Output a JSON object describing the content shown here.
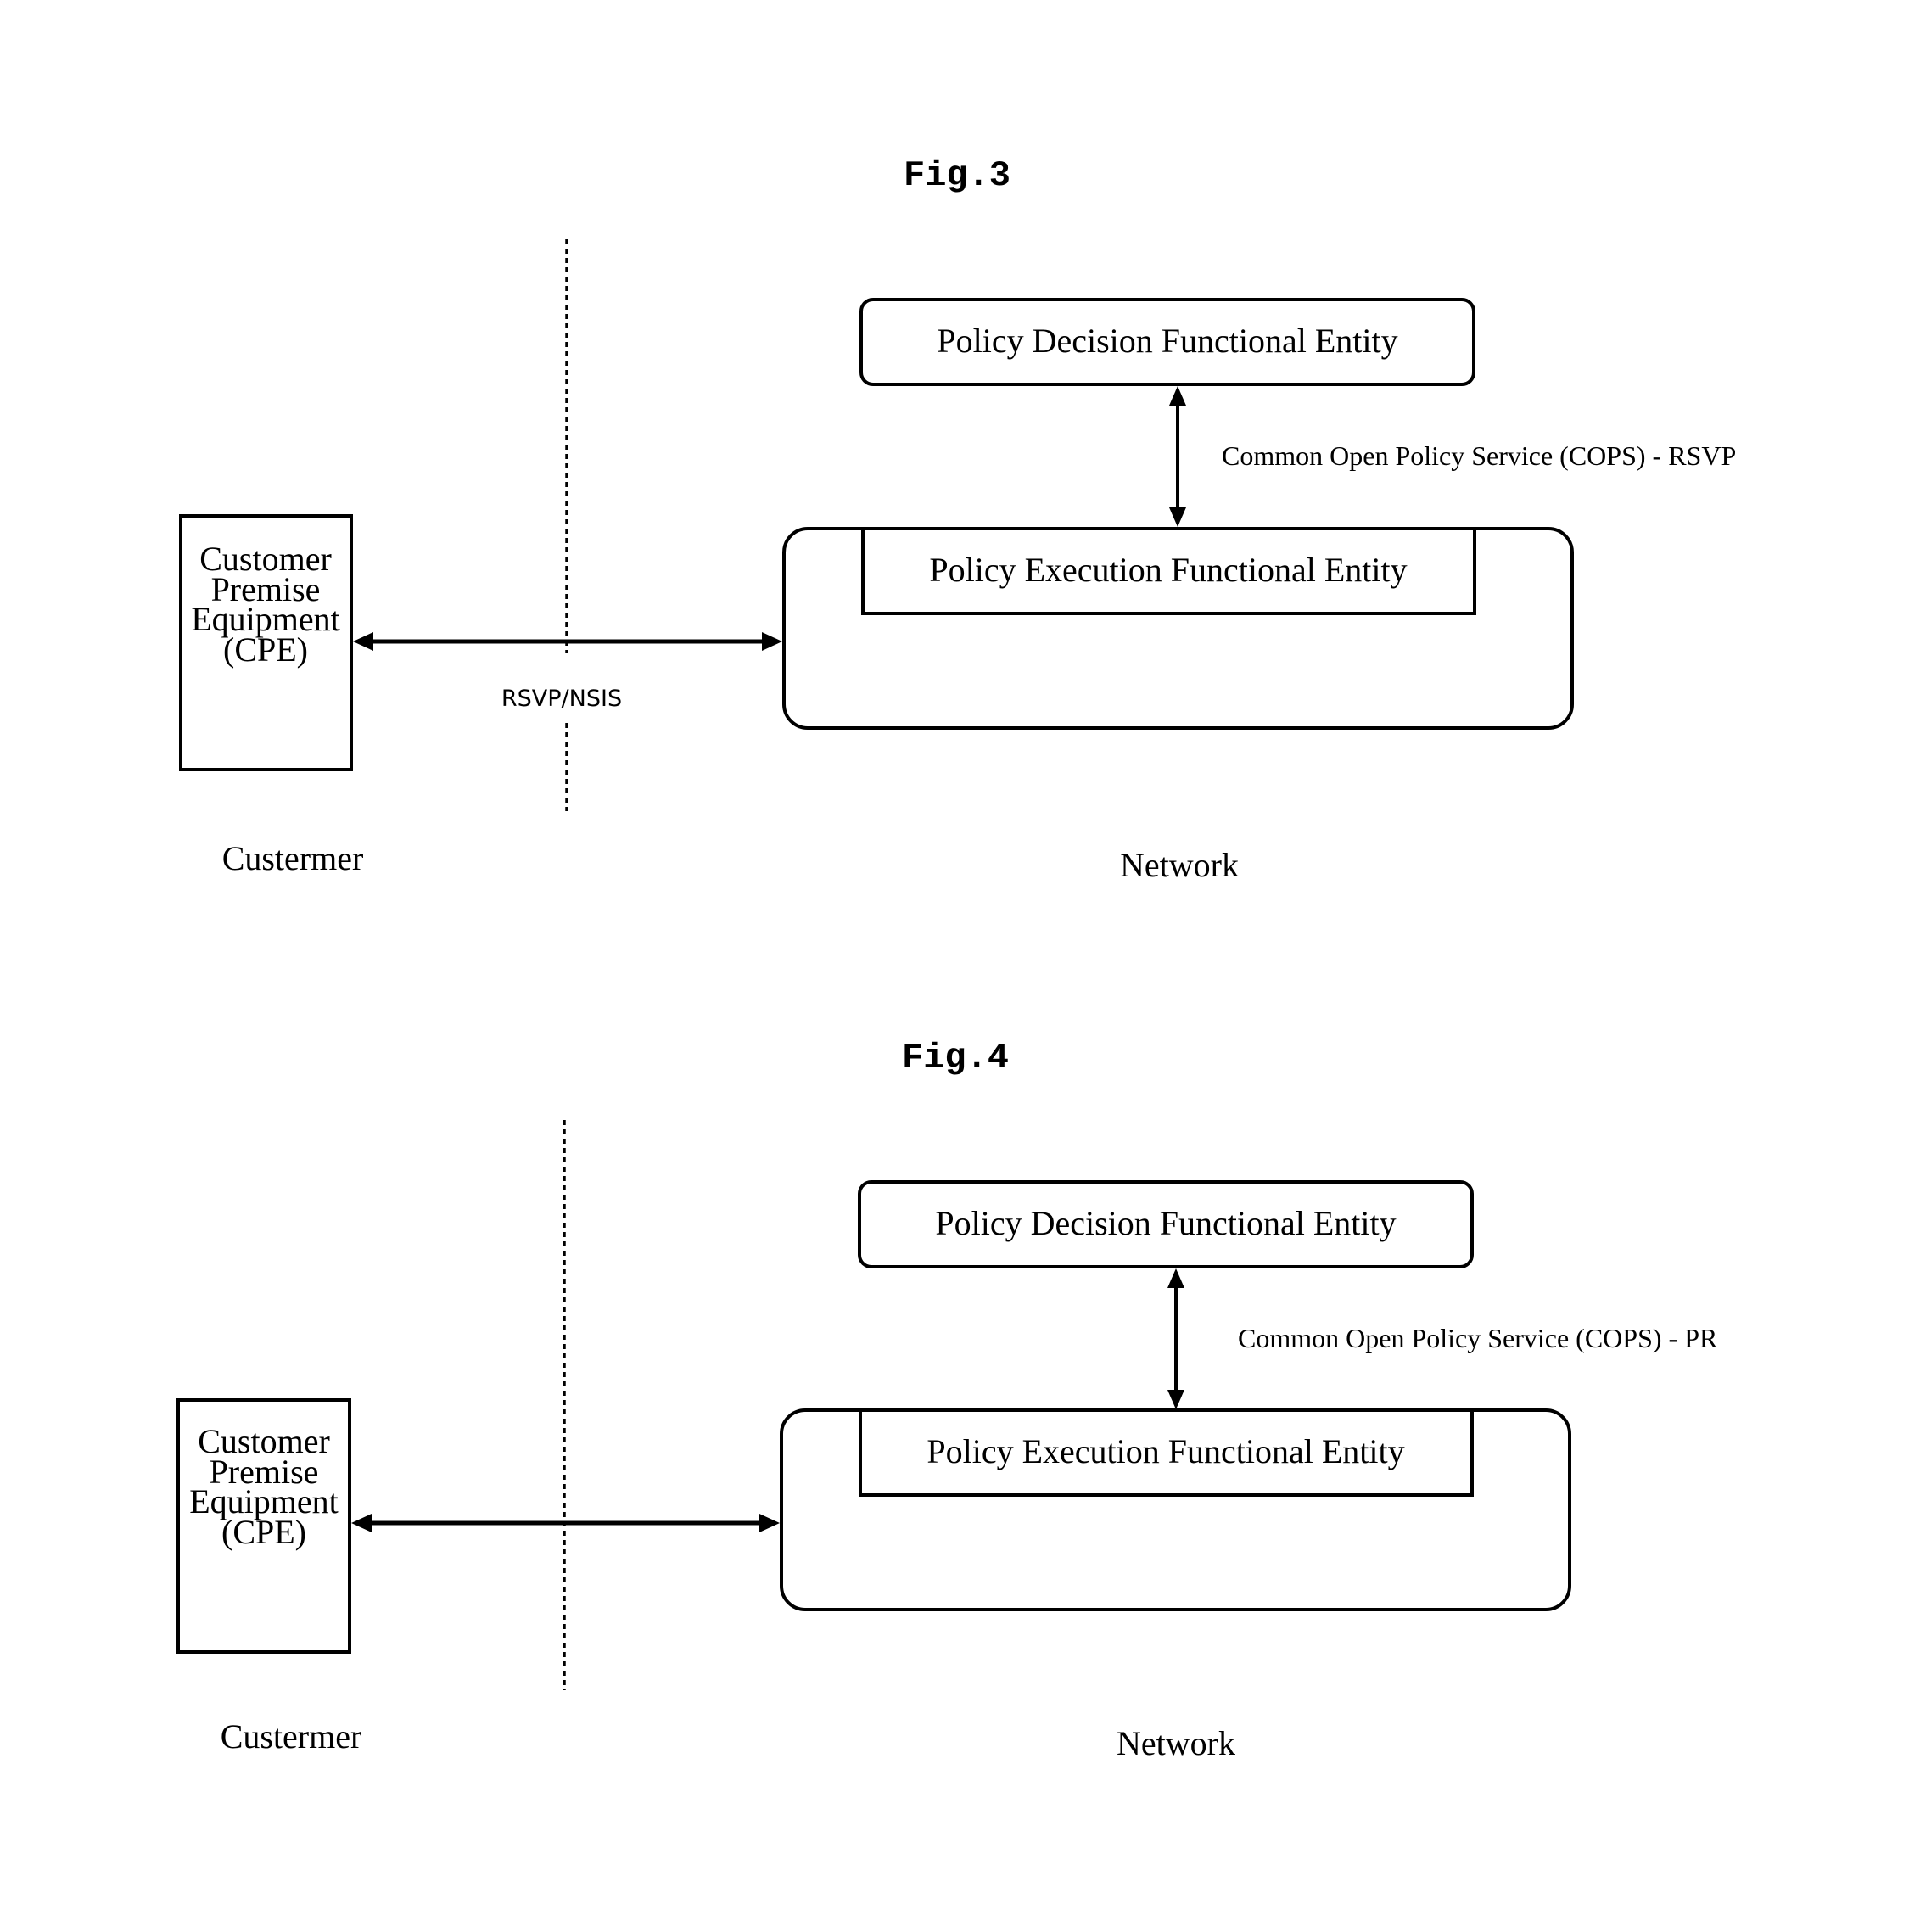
{
  "figures": [
    {
      "title": "Fig.3",
      "decision_entity": "Policy Decision Functional Entity",
      "execution_entity": "Policy Execution Functional Entity",
      "decision_execution_link": "Common Open Policy Service (COPS) - RSVP",
      "cpe_lines": [
        "Customer",
        "Premise",
        "Equipment",
        "(CPE)"
      ],
      "cpe_network_link": "RSVP/NSIS",
      "customer_side_label": "Custermer",
      "network_side_label": "Network"
    },
    {
      "title": "Fig.4",
      "decision_entity": "Policy Decision Functional Entity",
      "execution_entity": "Policy Execution Functional Entity",
      "decision_execution_link": "Common Open Policy Service (COPS) - PR",
      "cpe_lines": [
        "Customer",
        "Premise",
        "Equipment",
        "(CPE)"
      ],
      "cpe_network_link": "",
      "customer_side_label": "Custermer",
      "network_side_label": "Network"
    }
  ]
}
